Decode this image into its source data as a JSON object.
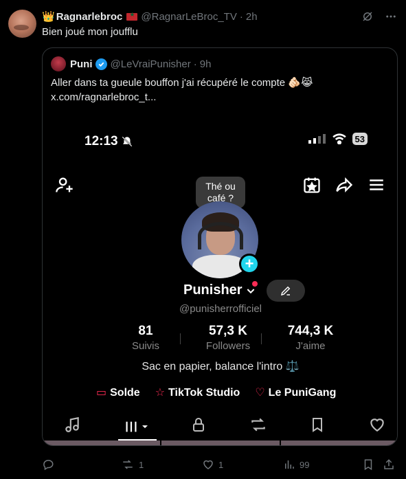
{
  "tweet": {
    "crown_emoji": "👑",
    "display_name": "Ragnarlebroc",
    "handle": "@RagnarLeBroc_TV",
    "separator": "·",
    "time": "2h",
    "text": "Bien joué mon joufflu"
  },
  "quote": {
    "display_name": "Puni",
    "handle": "@LeVraiPunisher",
    "separator": "·",
    "time": "9h",
    "text_line1": "Aller dans ta gueule bouffon j'ai récupéré le compte 🫵🏻😹",
    "text_line2": "x.com/ragnarlebroc_t..."
  },
  "phone": {
    "status_time": "12:13",
    "battery": "53",
    "bubble_line1": "Thé ou",
    "bubble_line2": "café ?",
    "profile_name": "Punisher",
    "profile_handle": "@punisherrofficiel",
    "stats": [
      {
        "number": "81",
        "label": "Suivis"
      },
      {
        "number": "57,3 K",
        "label": "Followers"
      },
      {
        "number": "744,3 K",
        "label": "J'aime"
      }
    ],
    "bio": "Sac en papier, balance l'intro ⚖️",
    "links": [
      {
        "label": "Solde"
      },
      {
        "label": "TikTok Studio"
      },
      {
        "label": "Le PuniGang"
      }
    ]
  },
  "actions": {
    "reply_count": "",
    "retweet_count": "1",
    "like_count": "1",
    "views_count": "99"
  },
  "colors": {
    "accent_blue": "#1d9bf0",
    "tiktok_red": "#fe2c55",
    "tiktok_cyan": "#20d5ec",
    "muted": "#71767b"
  }
}
